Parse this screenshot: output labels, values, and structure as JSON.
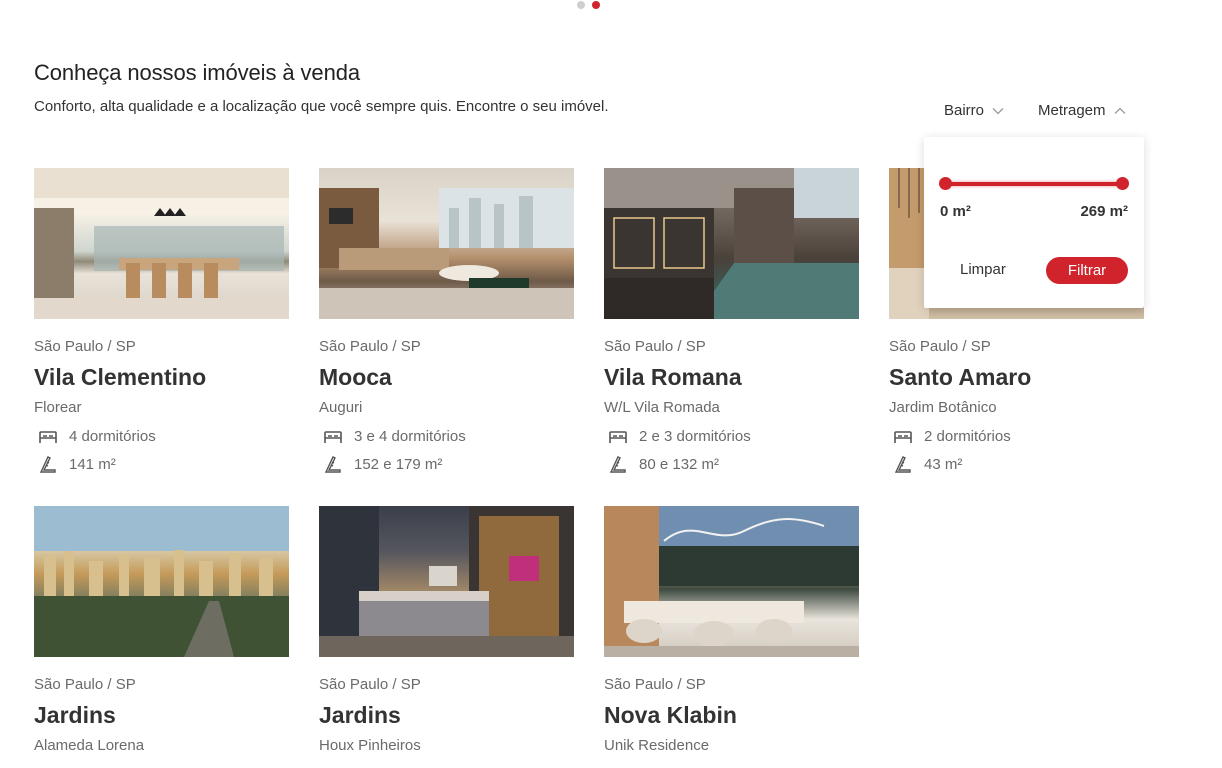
{
  "carousel": {
    "dots": 2,
    "active_index": 1
  },
  "header": {
    "title": "Conheça nossos imóveis à venda",
    "subtitle": "Conforto, alta qualidade e a localização que você sempre quis. Encontre o seu imóvel."
  },
  "filters": {
    "bairro_label": "Bairro",
    "metragem_label": "Metragem",
    "metragem_panel": {
      "min_label": "0 m²",
      "max_label": "269 m²",
      "min_value": 0,
      "max_value": 269,
      "clear_label": "Limpar",
      "apply_label": "Filtrar"
    }
  },
  "colors": {
    "accent": "#d0232b",
    "text": "#333333",
    "muted": "#6a6a6a"
  },
  "icons": {
    "rooms": "bed-icon",
    "area": "ruler-icon",
    "dropdown": "chevron-down-icon",
    "dropdown_open": "chevron-up-icon"
  },
  "listings": [
    {
      "city": "São Paulo / SP",
      "neighborhood": "Vila Clementino",
      "project": "Florear",
      "rooms": "4 dormitórios",
      "area": "141 m²"
    },
    {
      "city": "São Paulo / SP",
      "neighborhood": "Mooca",
      "project": "Auguri",
      "rooms": "3 e 4 dormitórios",
      "area": "152 e 179 m²"
    },
    {
      "city": "São Paulo / SP",
      "neighborhood": "Vila Romana",
      "project": "W/L Vila Romada",
      "rooms": "2 e 3 dormitórios",
      "area": "80 e 132 m²"
    },
    {
      "city": "São Paulo / SP",
      "neighborhood": "Santo Amaro",
      "project": "Jardim Botânico",
      "rooms": "2 dormitórios",
      "area": "43 m²"
    },
    {
      "city": "São Paulo / SP",
      "neighborhood": "Jardins",
      "project": "Alameda Lorena"
    },
    {
      "city": "São Paulo / SP",
      "neighborhood": "Jardins",
      "project": "Houx Pinheiros"
    },
    {
      "city": "São Paulo / SP",
      "neighborhood": "Nova Klabin",
      "project": "Unik Residence"
    }
  ]
}
